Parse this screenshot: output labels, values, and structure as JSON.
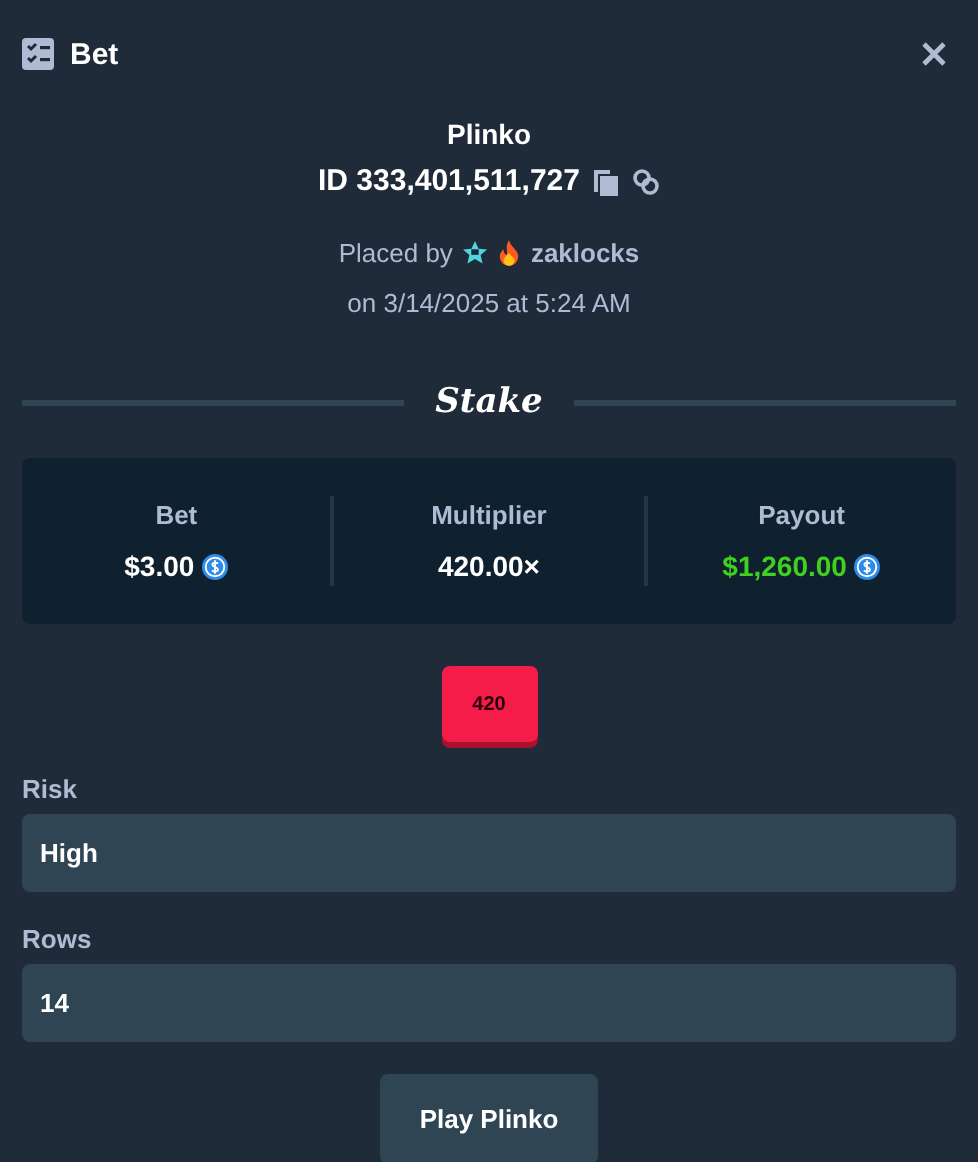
{
  "window": {
    "title": "Bet"
  },
  "game": "Plinko",
  "bet_id": "ID 333,401,511,727",
  "placed_by": {
    "prefix": "Placed by",
    "user": "zaklocks"
  },
  "date": "on 3/14/2025 at 5:24 AM",
  "brand": "Stake",
  "stats": [
    {
      "label": "Bet",
      "value": "$3.00",
      "color": "#ffffff",
      "coin": true
    },
    {
      "label": "Multiplier",
      "value": "420.00×",
      "color": "#ffffff",
      "coin": false
    },
    {
      "label": "Payout",
      "value": "$1,260.00",
      "color": "#3fd11f",
      "coin": true
    }
  ],
  "result_chip": "420",
  "fields": [
    {
      "label": "Risk",
      "value": "High"
    },
    {
      "label": "Rows",
      "value": "14"
    }
  ],
  "button": "Play Plinko"
}
